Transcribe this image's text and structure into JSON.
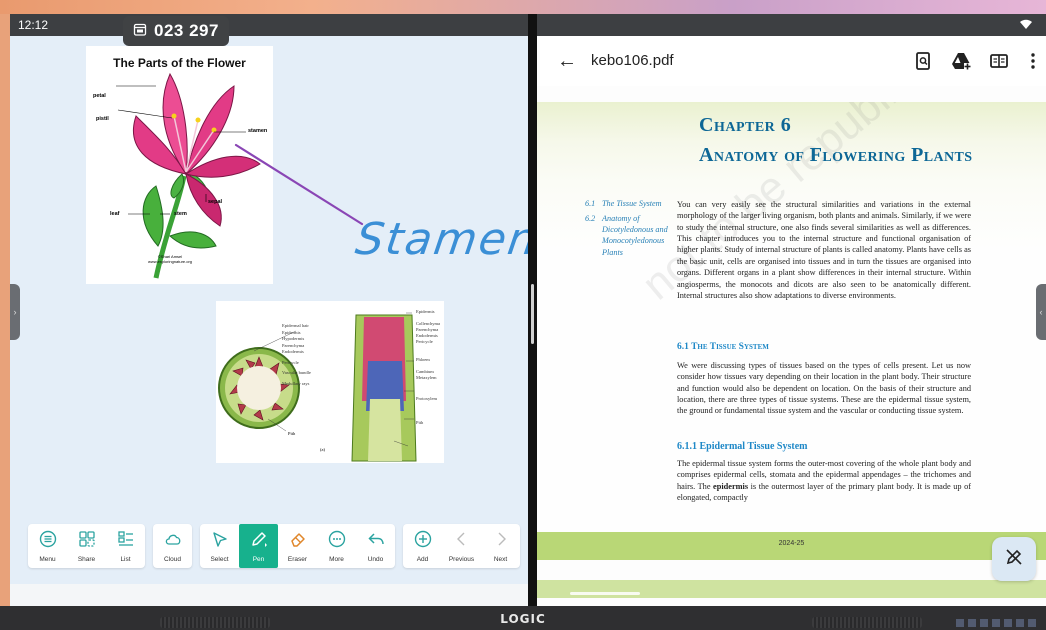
{
  "status": {
    "time": "12:12"
  },
  "code_badge": {
    "code": "023 297"
  },
  "whiteboard": {
    "flower_title": "The Parts of the Flower",
    "flower_labels": {
      "petal": "petal",
      "pistil": "pistil",
      "stamen": "stamen",
      "sepal": "sepal",
      "leaf": "leaf",
      "stem": "stem"
    },
    "flower_credit": "©Shari Amsel\nwww.exploringnature.org",
    "handwriting": "Stamen",
    "cross_labels": [
      "Epidermal hair",
      "Epidermis",
      "Hypodermis",
      "Parenchyma",
      "Endodermis",
      "Pericycle",
      "Vascular bundle",
      "Medullary rays",
      "Pith"
    ],
    "long_labels": [
      "Epidermis",
      "Collenchyma",
      "Parenchyma",
      "Endodermis",
      "Pericycle",
      "Phloem",
      "Cambium",
      "Metaxylem",
      "Protoxylem",
      "Pith"
    ],
    "figure_tag": "(a)"
  },
  "toolbar": {
    "groups": [
      [
        {
          "id": "menu",
          "label": "Menu",
          "icon": "menu-icon"
        },
        {
          "id": "share",
          "label": "Share",
          "icon": "share-icon"
        },
        {
          "id": "list",
          "label": "List",
          "icon": "list-icon"
        }
      ],
      [
        {
          "id": "cloud",
          "label": "Cloud",
          "icon": "cloud-icon"
        }
      ],
      [
        {
          "id": "select",
          "label": "Select",
          "icon": "select-icon"
        },
        {
          "id": "pen",
          "label": "Pen",
          "icon": "pen-icon",
          "active": true
        },
        {
          "id": "eraser",
          "label": "Eraser",
          "icon": "eraser-icon"
        },
        {
          "id": "more",
          "label": "More",
          "icon": "more-icon"
        },
        {
          "id": "undo",
          "label": "Undo",
          "icon": "undo-icon"
        }
      ],
      [
        {
          "id": "add",
          "label": "Add",
          "icon": "add-icon"
        },
        {
          "id": "previous",
          "label": "Previous",
          "icon": "chevron-left-icon",
          "disabled": true
        },
        {
          "id": "next",
          "label": "Next",
          "icon": "chevron-right-icon",
          "disabled": true
        }
      ]
    ]
  },
  "pdf": {
    "file_name": "kebo106.pdf",
    "chapter": "Chapter 6",
    "title": "Anatomy of Flowering Plants",
    "watermark": "not to be republished",
    "toc": [
      {
        "no": "6.1",
        "text": "The Tissue System"
      },
      {
        "no": "6.2",
        "text": "Anatomy of Dicotyledonous and Monocotyledonous Plants"
      }
    ],
    "intro": "You can very easily see the structural similarities and variations in the external morphology of the larger living organism, both plants and animals. Similarly, if we were to study the internal structure, one also finds several similarities as well as differences. This chapter introduces you to the internal structure and functional organisation of higher plants. Study of internal structure of plants is called anatomy. Plants have cells as the basic unit, cells are organised into tissues and in turn the tissues are organised into organs. Different organs in a plant show differences in their internal structure. Within angiosperms, the monocots and dicots are also seen to be anatomically different. Internal structures also show adaptations to diverse environments.",
    "section_61": "6.1   The Tissue System",
    "para_61": "We were discussing types of tissues based on the types of cells present. Let us now consider how tissues vary depending on their location in the plant body. Their structure and function would also be dependent on location. On the basis of their structure and location, there are three types of tissue systems. These are the epidermal tissue system, the ground or fundamental tissue system and the vascular or conducting tissue system.",
    "section_611": "6.1.1   Epidermal Tissue System",
    "para_611_a": "The epidermal tissue system forms the outer-most covering of the whole plant body and comprises epidermal cells, stomata and the epidermal appendages – the trichomes and hairs. The ",
    "para_611_b": "epidermis",
    "para_611_c": " is the outermost layer of the primary plant body. It is made up of elongated, compactly",
    "footer_year": "2024-25"
  },
  "monitor": {
    "brand": "LOGIC"
  }
}
